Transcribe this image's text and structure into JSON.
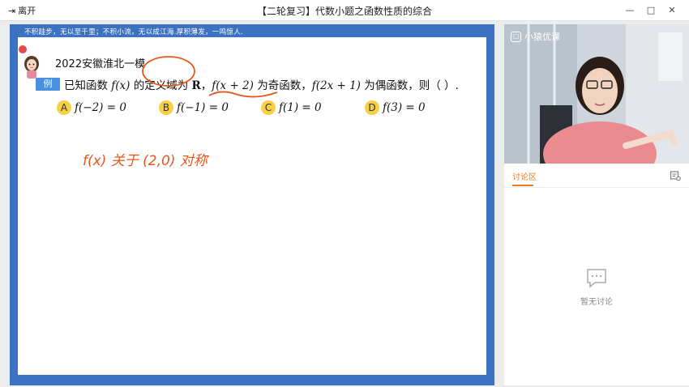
{
  "titlebar": {
    "leave_label": "离开",
    "title": "【二轮复习】代数小题之函数性质的综合",
    "minimize": "—",
    "maximize": "□",
    "close": "✕"
  },
  "slide": {
    "motto": "不积跬步，无以至千里；不积小流，无以成江海.厚积薄发，一鸣惊人.",
    "exam_source": "2022安徽淮北一模",
    "example_badge": "例",
    "question": {
      "part1": "已知函数 ",
      "fx": "f(x)",
      "part2": " 的定义域为 ",
      "R": "R",
      "part3": "，",
      "fx2": "f(x + 2)",
      "part4": " 为奇函数，",
      "f2x1": "f(2x + 1)",
      "part5": " 为偶函数，则（  ）."
    },
    "options": [
      {
        "letter": "A",
        "text": "f(−2) = 0"
      },
      {
        "letter": "B",
        "text": "f(−1) = 0"
      },
      {
        "letter": "C",
        "text": "f(1) = 0"
      },
      {
        "letter": "D",
        "text": "f(3) = 0"
      }
    ],
    "handwriting": "f(x) 关于 (2,0) 对称",
    "ink_color": "#e8561b"
  },
  "right_panel": {
    "logo_text": "小猿优课",
    "discussion_tab": "讨论区",
    "empty_text": "暂无讨论"
  }
}
